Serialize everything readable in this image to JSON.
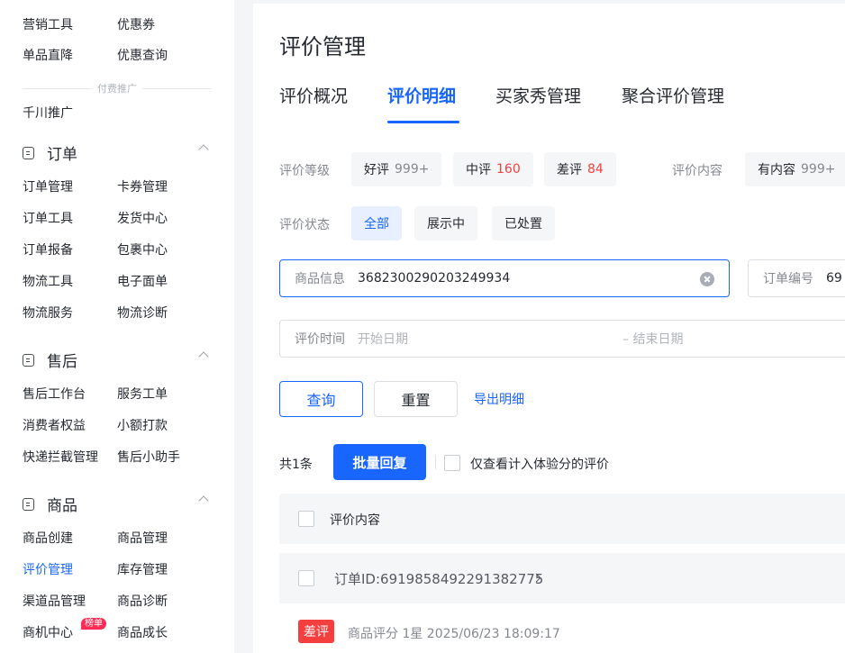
{
  "sidebar": {
    "top_links": [
      "营销工具",
      "优惠券",
      "单品直降",
      "优惠查询"
    ],
    "paid_divider": "付费推广",
    "paid_link": "千川推广",
    "sections": [
      {
        "title": "订单",
        "icon": "order-icon",
        "links": [
          "订单管理",
          "卡券管理",
          "订单工具",
          "发货中心",
          "订单报备",
          "包裹中心",
          "物流工具",
          "电子面单",
          "物流服务",
          "物流诊断"
        ]
      },
      {
        "title": "售后",
        "icon": "aftersale-icon",
        "links": [
          "售后工作台",
          "服务工单",
          "消费者权益",
          "小额打款",
          "快递拦截管理",
          "售后小助手"
        ]
      },
      {
        "title": "商品",
        "icon": "product-icon",
        "links": [
          "商品创建",
          "商品管理",
          "评价管理",
          "库存管理",
          "渠道品管理",
          "商品诊断",
          "商机中心",
          "商品成长"
        ]
      }
    ],
    "badge": "榜单",
    "active_link": "评价管理"
  },
  "page": {
    "title": "评价管理",
    "tabs": [
      "评价概况",
      "评价明细",
      "买家秀管理",
      "聚合评价管理"
    ],
    "active_tab": "评价明细"
  },
  "filters": {
    "grade_label": "评价等级",
    "grade_chips": [
      {
        "label": "好评",
        "count": "999+"
      },
      {
        "label": "中评",
        "count": "160"
      },
      {
        "label": "差评",
        "count": "84"
      }
    ],
    "content_label": "评价内容",
    "content_chip": {
      "label": "有内容",
      "count": "999+"
    },
    "status_label": "评价状态",
    "status_chips": [
      "全部",
      "展示中",
      "已处置"
    ],
    "product_label": "商品信息",
    "product_value": "3682300290203249934",
    "order_label": "订单编号",
    "order_value": "69",
    "time_label": "评价时间",
    "start_placeholder": "开始日期",
    "end_placeholder": "– 结束日期"
  },
  "actions": {
    "query": "查询",
    "reset": "重置",
    "export": "导出明细"
  },
  "list": {
    "total": "共1条",
    "batch_reply": "批量回复",
    "only_exp": "仅查看计入体验分的评价",
    "header": "评价内容",
    "order_id": "订单ID:6919858492291382775",
    "rating_tag": "差评",
    "rating_text": "商品评分 1星  2025/06/23 18:09:17"
  },
  "colors": {
    "accent": "#1966ff",
    "danger": "#f53f3f"
  }
}
